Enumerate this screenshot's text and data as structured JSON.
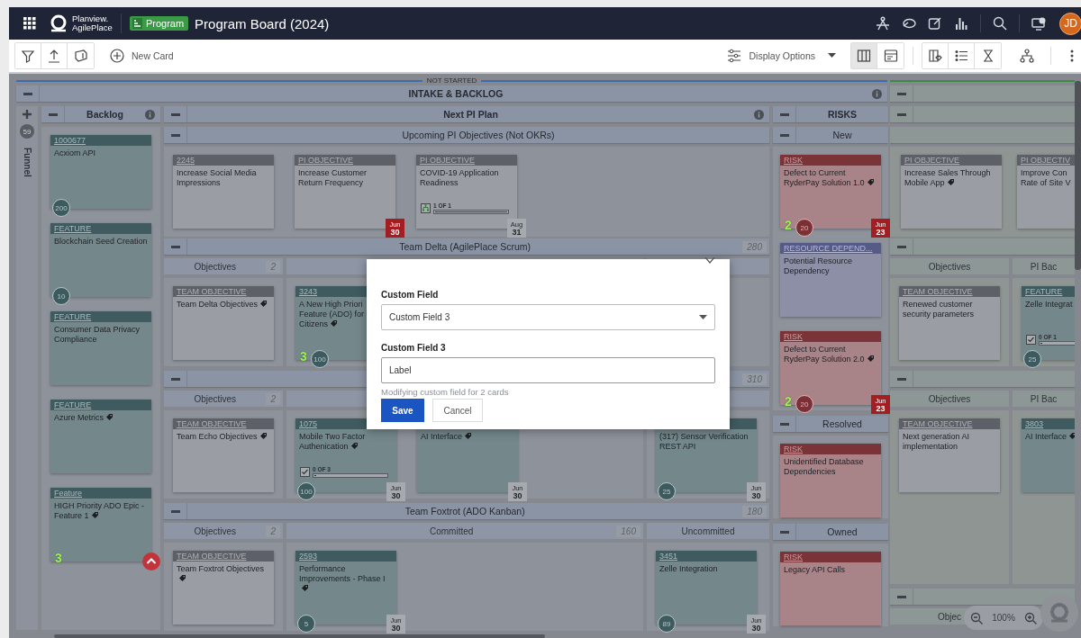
{
  "top_bar": {
    "logo_line1": "Planview.",
    "logo_line2": "AgilePlace",
    "board_type": "Program",
    "board_title": "Program Board (2024)",
    "avatar_initials": "JD"
  },
  "toolbar": {
    "new_card": "New Card",
    "display_options": "Display Options",
    "view_modes": [
      {
        "selected": true
      },
      {
        "selected": false
      }
    ]
  },
  "board": {
    "status_label": "NOT STARTED",
    "intake": {
      "title": "INTAKE & BACKLOG",
      "funnel": {
        "title": "Funnel",
        "count": "59"
      },
      "backlog": {
        "title": "Backlog",
        "cards": [
          {
            "kind": "feature",
            "header": "1000677",
            "title": "Acxiom API",
            "tagged": false,
            "high_priority": false,
            "size": "200"
          },
          {
            "kind": "feature",
            "header": "FEATURE",
            "title": "Blockchain Seed Creation",
            "tagged": false,
            "high_priority": false,
            "size": "10"
          },
          {
            "kind": "feature",
            "header": "FEATURE",
            "title": "Consumer Data Privacy Compliance",
            "tagged": false,
            "high_priority": false
          },
          {
            "kind": "feature",
            "header": "FEATURE",
            "title": "Azure Metrics",
            "tagged": true,
            "high_priority": false
          },
          {
            "kind": "feature",
            "header": "Feature",
            "title": "HIGH Priority ADO Epic - Feature 1",
            "tagged": true,
            "high_priority": true,
            "count": "3"
          }
        ]
      },
      "next_pi_plan": {
        "title": "Next PI Plan",
        "swimlanes": [
          {
            "title": "Upcoming PI Objectives (Not OKRs)",
            "cards": [
              {
                "kind": "objective",
                "header": "2245",
                "title": "Increase Social Media Impressions",
                "tagged": false,
                "high_priority": false
              },
              {
                "kind": "objective",
                "header": "PI OBJECTIVE",
                "title": "Increase Customer Return Frequency",
                "tagged": false,
                "high_priority": false,
                "due": {
                  "month": "Jun",
                  "day": "30",
                  "overdue": true
                }
              },
              {
                "kind": "objective",
                "header": "PI OBJECTIVE",
                "title": "COVID-19 Application Readiness",
                "tagged": false,
                "high_priority": false,
                "progress": {
                  "kind": "children",
                  "text": "1 OF 1",
                  "level": 1
                },
                "due": {
                  "month": "Aug",
                  "day": "31",
                  "overdue": false
                }
              }
            ]
          },
          {
            "title": "Team Delta (AgilePlace Scrum)",
            "limit": "280",
            "columns": [
              {
                "title": "Objectives",
                "limit": "2",
                "cards": [
                  {
                    "kind": "objective",
                    "header": "TEAM OBJECTIVE",
                    "title": "Team Delta Objectives",
                    "tagged": true,
                    "high_priority": false
                  }
                ]
              },
              {
                "cards": [
                  {
                    "kind": "feature",
                    "header": "3243",
                    "title": "A New High Priori\nFeature (ADO) for\nCitizens",
                    "tagged": true,
                    "high_priority": false,
                    "count": "3",
                    "size": "100"
                  }
                ]
              },
              {}
            ]
          },
          {
            "limit": "310",
            "columns": [
              {
                "title": "Objectives",
                "limit": "2",
                "cards": [
                  {
                    "kind": "objective",
                    "header": "TEAM OBJECTIVE",
                    "title": "Team Echo Objectives",
                    "tagged": true,
                    "high_priority": false
                  }
                ]
              },
              {
                "cards": [
                  {
                    "kind": "feature",
                    "header": "1075",
                    "title": "Mobile Two Factor Authenication",
                    "tagged": true,
                    "high_priority": false,
                    "progress": {
                      "kind": "tasks",
                      "text": "0 OF 3",
                      "level": 0
                    },
                    "size": "100",
                    "due": {
                      "month": "Jun",
                      "day": "30",
                      "overdue": false
                    }
                  },
                  {
                    "kind": "feature",
                    "title": "AI Interface",
                    "tagged": true,
                    "high_priority": false,
                    "due": {
                      "month": "Jun",
                      "day": "30",
                      "overdue": false
                    }
                  }
                ]
              },
              {
                "cards": [
                  {
                    "kind": "feature",
                    "title": "(317) Sensor Verification REST API",
                    "tagged": false,
                    "high_priority": false,
                    "size": "25",
                    "due": {
                      "month": "Jun",
                      "day": "30",
                      "overdue": false
                    }
                  }
                ]
              }
            ]
          },
          {
            "title": "Team Foxtrot (ADO Kanban)",
            "limit": "180",
            "columns": [
              {
                "title": "Objectives",
                "limit": "2",
                "cards": [
                  {
                    "kind": "objective",
                    "header": "TEAM OBJECTIVE",
                    "title": "Team Foxtrot Objectives",
                    "tagged": true,
                    "high_priority": false
                  }
                ]
              },
              {
                "title": "Committed",
                "limit": "160",
                "cards": [
                  {
                    "kind": "feature",
                    "header": "2593",
                    "title": "Performance Improvements - Phase I",
                    "tagged": true,
                    "high_priority": false,
                    "size": "5",
                    "due": {
                      "month": "Jun",
                      "day": "30",
                      "overdue": false
                    }
                  }
                ]
              },
              {
                "title": "Uncommitted",
                "cards": [
                  {
                    "kind": "feature",
                    "header": "3451",
                    "title": "Zelle Integration",
                    "tagged": false,
                    "high_priority": false,
                    "size": "89",
                    "due": {
                      "month": "Jun",
                      "day": "30",
                      "overdue": false
                    }
                  }
                ]
              }
            ]
          }
        ]
      },
      "risks": {
        "title": "RISKS",
        "sublanes": [
          {
            "title": "New",
            "cards": [
              {
                "kind": "risk",
                "header": "RISK",
                "title": "Defect to Current RyderPay Solution 1.0",
                "tagged": true,
                "high_priority": false,
                "count": "2",
                "size": "20",
                "due": {
                  "month": "Jun",
                  "day": "23",
                  "overdue": true
                }
              },
              {
                "kind": "dependency",
                "header": "RESOURCE DEPEND...",
                "title": "Potential Resource Dependency",
                "tagged": false,
                "high_priority": false
              },
              {
                "kind": "risk",
                "header": "RISK",
                "title": "Defect to Current RyderPay Solution 2.0",
                "tagged": true,
                "high_priority": false,
                "count": "2",
                "size": "20",
                "due": {
                  "month": "Jun",
                  "day": "23",
                  "overdue": true
                }
              }
            ]
          },
          {
            "title": "Resolved",
            "cards": [
              {
                "kind": "risk",
                "header": "RISK",
                "title": "Unidentified Database Dependencies",
                "tagged": false,
                "high_priority": false
              }
            ]
          },
          {
            "title": "Owned",
            "cards": [
              {
                "kind": "risk",
                "header": "RISK",
                "title": "Legacy API Calls",
                "tagged": false,
                "high_priority": false
              }
            ]
          }
        ]
      }
    },
    "right_lane": {
      "sections": [
        {
          "collapsible": false,
          "cards": [
            {
              "kind": "objective",
              "header": "PI OBJECTIVE",
              "title": "Increase Sales Through Mobile App",
              "tagged": true,
              "high_priority": false
            },
            {
              "kind": "objective",
              "header": "PI OBJECTIV",
              "title": "Improve Con\nRate of Site V",
              "tagged": false,
              "high_priority": false
            }
          ]
        },
        {
          "collapsible": true,
          "columns": [
            {
              "title": "Objectives",
              "cards": [
                {
                  "kind": "objective",
                  "header": "TEAM OBJECTIVE",
                  "title": "Renewed customer security parameters",
                  "tagged": false,
                  "high_priority": false
                }
              ]
            },
            {
              "title": "PI Bac",
              "cards": [
                {
                  "kind": "feature",
                  "header": "FEATURE",
                  "title": "Zelle Integrat",
                  "tagged": false,
                  "high_priority": false,
                  "progress": {
                    "kind": "tasks",
                    "text": "0 OF 1",
                    "level": 0
                  },
                  "size": "25"
                }
              ]
            }
          ]
        },
        {
          "collapsible": true,
          "columns": [
            {
              "title": "Objectives",
              "cards": [
                {
                  "kind": "objective",
                  "header": "TEAM OBJECTIVE",
                  "title": "Next generation AI implementation",
                  "tagged": false,
                  "high_priority": false
                }
              ]
            },
            {
              "title": "PI Bac",
              "cards": [
                {
                  "kind": "feature",
                  "header": "3803",
                  "title": "AI Interface",
                  "tagged": true,
                  "high_priority": false
                }
              ]
            }
          ]
        },
        {
          "collapsible": true,
          "columns": [
            {
              "title": "Objec"
            }
          ]
        }
      ]
    }
  },
  "modal": {
    "field_label": "Custom Field",
    "field_value": "Custom Field 3",
    "value_label": "Custom Field 3",
    "value": "Label",
    "hint": "Modifying custom field for 2 cards",
    "save": "Save",
    "cancel": "Cancel"
  },
  "zoom": {
    "level": "100%"
  }
}
